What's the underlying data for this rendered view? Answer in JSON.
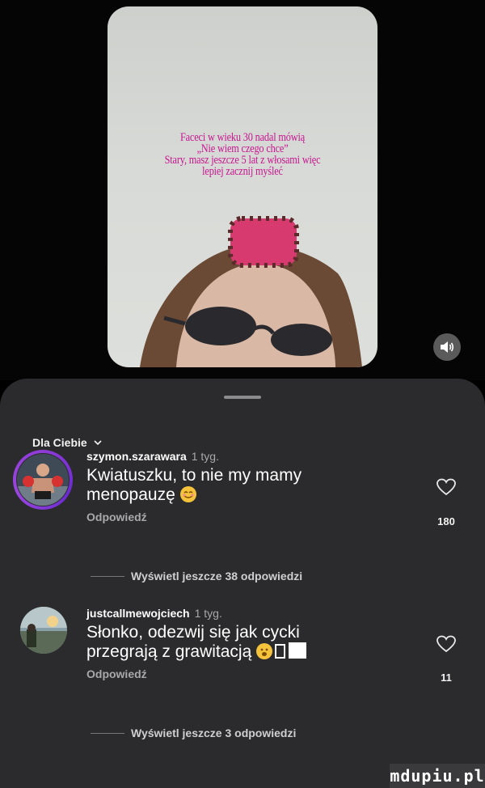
{
  "video": {
    "overlay_lines": [
      "Faceci w wieku 30 nadal mówią",
      "„Nie wiem czego chce”",
      "Stary, masz jeszcze 5 lat z włosami więc",
      "lepiej zacznij myśleć"
    ],
    "sound_icon": "speaker-icon"
  },
  "sheet": {
    "filter_label": "Dla Ciebie",
    "filter_icon": "chevron-down-icon"
  },
  "comments": [
    {
      "username": "szymon.szarawara",
      "time": "1 tyg.",
      "text_part1": "Kwiatuszku, to nie my mamy menopauzę",
      "reply_label": "Odpowiedź",
      "likes": "180",
      "more_replies": "Wyświetl jeszcze 38 odpowiedzi"
    },
    {
      "username": "justcallmewojciech",
      "time": "1 tyg.",
      "text_part1": "Słonko, odezwij się jak cycki przegrają z grawitacją",
      "reply_label": "Odpowiedź",
      "likes": "11",
      "more_replies": "Wyświetl jeszcze 3 odpowiedzi"
    }
  ],
  "watermark": "mdupiu.pl",
  "colors": {
    "overlay_text": "#c8168f",
    "sheet_bg": "#2b2b2d",
    "story_ring": "#8f3bd6"
  }
}
